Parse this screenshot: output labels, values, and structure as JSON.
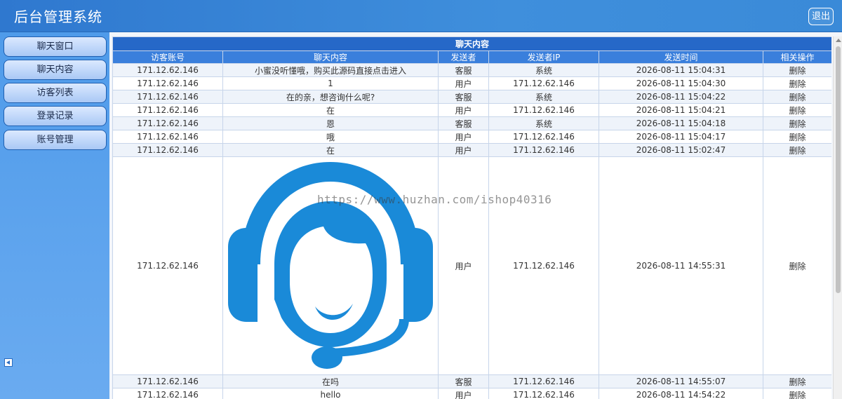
{
  "header": {
    "title": "后台管理系统",
    "logout_label": "退出"
  },
  "sidebar": {
    "items": [
      {
        "label": "聊天窗口"
      },
      {
        "label": "聊天内容"
      },
      {
        "label": "访客列表"
      },
      {
        "label": "登录记录"
      },
      {
        "label": "账号管理"
      }
    ]
  },
  "table": {
    "caption": "聊天内容",
    "columns": [
      "访客账号",
      "聊天内容",
      "发送者",
      "发送者IP",
      "发送时间",
      "相关操作"
    ],
    "rows": [
      {
        "visitor": "171.12.62.146",
        "content": "小蜜没听懂哦，购买此源码直接点击进入",
        "sender": "客服",
        "ip": "系统",
        "time": "2026-08-11 15:04:31",
        "action": "删除"
      },
      {
        "visitor": "171.12.62.146",
        "content": "1",
        "sender": "用户",
        "ip": "171.12.62.146",
        "time": "2026-08-11 15:04:30",
        "action": "删除"
      },
      {
        "visitor": "171.12.62.146",
        "content": "在的亲，想咨询什么呢?",
        "sender": "客服",
        "ip": "系统",
        "time": "2026-08-11 15:04:22",
        "action": "删除"
      },
      {
        "visitor": "171.12.62.146",
        "content": "在",
        "sender": "用户",
        "ip": "171.12.62.146",
        "time": "2026-08-11 15:04:21",
        "action": "删除"
      },
      {
        "visitor": "171.12.62.146",
        "content": "恩",
        "sender": "客服",
        "ip": "系统",
        "time": "2026-08-11 15:04:18",
        "action": "删除"
      },
      {
        "visitor": "171.12.62.146",
        "content": "哦",
        "sender": "用户",
        "ip": "171.12.62.146",
        "time": "2026-08-11 15:04:17",
        "action": "删除"
      },
      {
        "visitor": "171.12.62.146",
        "content": "在",
        "sender": "用户",
        "ip": "171.12.62.146",
        "time": "2026-08-11 15:02:47",
        "action": "删除"
      },
      {
        "visitor": "171.12.62.146",
        "content_image": "customer-service-headset-icon",
        "sender": "用户",
        "ip": "171.12.62.146",
        "time": "2026-08-11 14:55:31",
        "action": "删除"
      },
      {
        "visitor": "171.12.62.146",
        "content": "在吗",
        "sender": "客服",
        "ip": "171.12.62.146",
        "time": "2026-08-11 14:55:07",
        "action": "删除"
      },
      {
        "visitor": "171.12.62.146",
        "content": "hello",
        "sender": "用户",
        "ip": "171.12.62.146",
        "time": "2026-08-11 14:54:22",
        "action": "删除"
      }
    ]
  },
  "watermark": "https://www.huzhan.com/ishop40316",
  "colors": {
    "header": "#3a88d8",
    "sidebar": "#5aa2ec",
    "table_caption": "#2668c8",
    "table_header": "#3a7fdc",
    "avatar": "#1a8ad8"
  }
}
